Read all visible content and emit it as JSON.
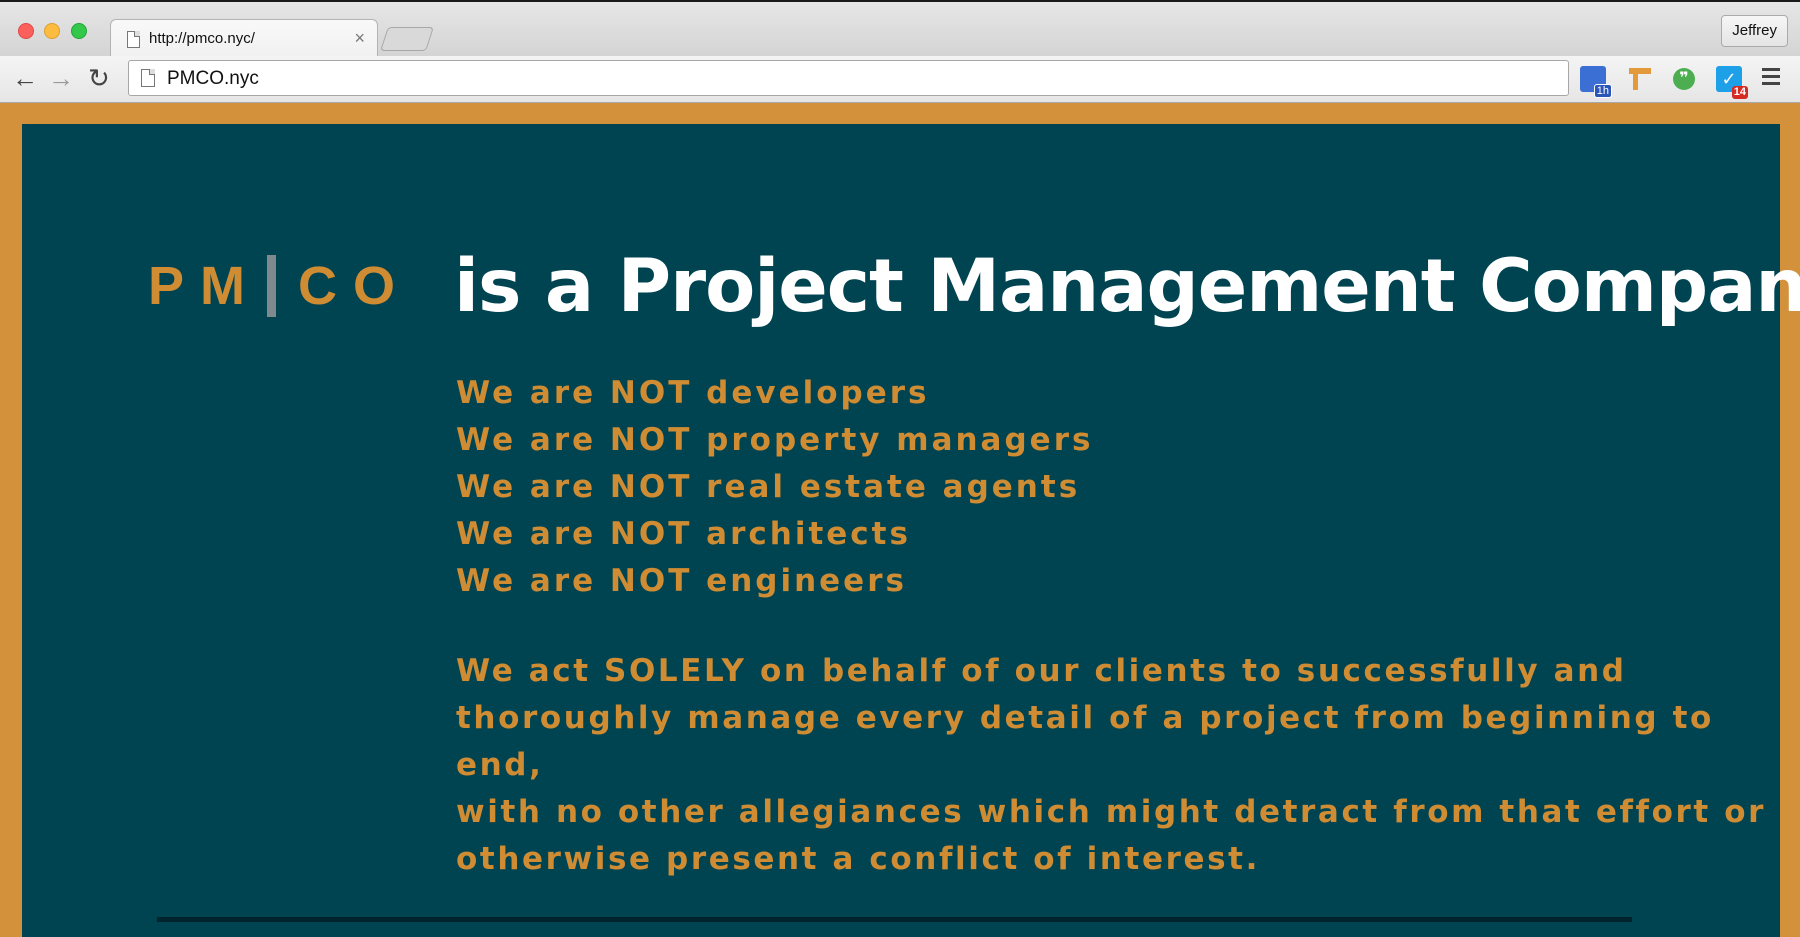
{
  "browser": {
    "tab_title": "http://pmco.nyc/",
    "tab_close": "×",
    "profile_name": "Jeffrey",
    "address": "PMCO.nyc",
    "nav": {
      "back": "←",
      "forward": "→",
      "reload": "↻"
    },
    "extensions": [
      {
        "icon": "calendar-extension-icon",
        "badge": "1h"
      },
      {
        "icon": "signpost-extension-icon"
      },
      {
        "icon": "hangouts-extension-icon",
        "glyph": "❞"
      },
      {
        "icon": "checker-extension-icon",
        "glyph": "✓",
        "badge": "14"
      }
    ]
  },
  "page": {
    "logo": {
      "left": "PM",
      "right": "CO"
    },
    "headline": "is a Project Management Company",
    "not_list": [
      "We are NOT developers",
      "We are NOT property managers",
      "We are NOT real estate agents",
      "We are NOT architects",
      "We are NOT engineers"
    ],
    "mission_lines": [
      "We act SOLELY on behalf of our clients to successfully and",
      "thoroughly manage every detail of a project from beginning to end,",
      "with no other allegiances which might detract from that effort or",
      "otherwise present a conflict of interest."
    ]
  },
  "colors": {
    "frame": "#d2913a",
    "panel": "#004452",
    "accent_text": "#d08c33",
    "headline_text": "#ffffff"
  }
}
